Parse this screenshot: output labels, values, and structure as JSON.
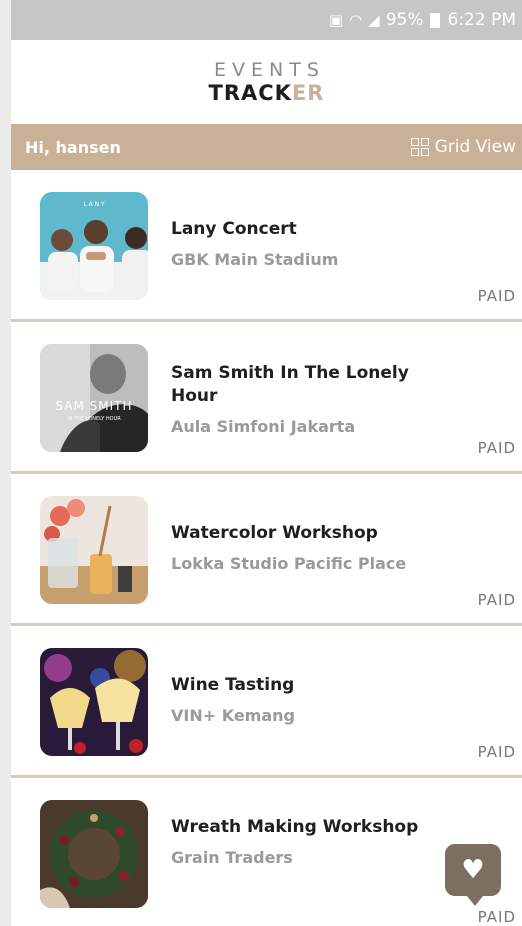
{
  "status_bar": {
    "battery": "95%",
    "time": "6:22 PM"
  },
  "app": {
    "logo_line1": "EVENTS",
    "logo_line2_main": "TRACK",
    "logo_line2_accent": "ER"
  },
  "greeting": {
    "text": "Hi, hansen",
    "view_toggle": "Grid View"
  },
  "events": [
    {
      "title": "Lany Concert",
      "venue": "GBK Main Stadium",
      "status": "PAID",
      "thumb_text": "L A N Y"
    },
    {
      "title": "Sam Smith In The Lonely Hour",
      "venue": "Aula Simfoni Jakarta",
      "status": "PAID",
      "thumb_text": "SAM SMITH",
      "thumb_sub": "IN THE LONELY HOUR"
    },
    {
      "title": "Watercolor Workshop",
      "venue": "Lokka Studio Pacific Place",
      "status": "PAID"
    },
    {
      "title": "Wine Tasting",
      "venue": "VIN+ Kemang",
      "status": "PAID"
    },
    {
      "title": "Wreath Making Workshop",
      "venue": "Grain Traders",
      "status": "PAID"
    }
  ],
  "colors": {
    "accent": "#c8b196",
    "fab": "#7d6e62",
    "divider": "#d6cdbf"
  }
}
